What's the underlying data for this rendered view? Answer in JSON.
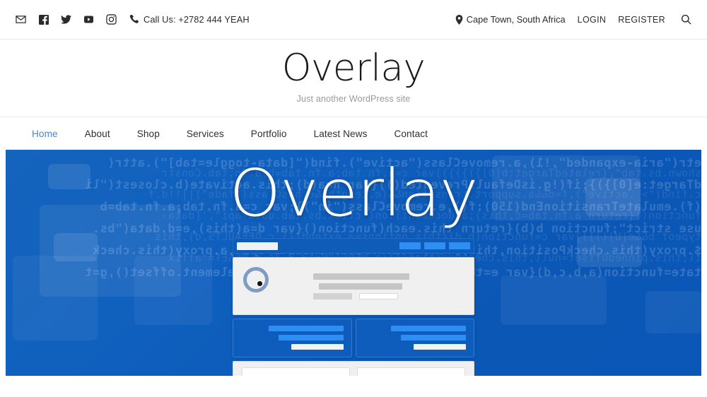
{
  "topbar": {
    "social_icons": [
      {
        "name": "email-icon",
        "label": "Email"
      },
      {
        "name": "facebook-icon",
        "label": "Facebook"
      },
      {
        "name": "twitter-icon",
        "label": "Twitter"
      },
      {
        "name": "youtube-icon",
        "label": "YouTube"
      },
      {
        "name": "instagram-icon",
        "label": "Instagram"
      }
    ],
    "phone_icon": "phone-icon",
    "call_text": "Call Us: +2782 444 YEAH",
    "location_icon": "map-pin-icon",
    "location_text": "Cape Town, South Africa",
    "login_label": "LOGIN",
    "register_label": "REGISTER",
    "search_icon": "search-icon"
  },
  "masthead": {
    "site_title": "Overlay",
    "tagline": "Just another WordPress site"
  },
  "nav": {
    "items": [
      {
        "label": "Home",
        "active": true
      },
      {
        "label": "About",
        "active": false
      },
      {
        "label": "Shop",
        "active": false
      },
      {
        "label": "Services",
        "active": false
      },
      {
        "label": "Portfolio",
        "active": false
      },
      {
        "label": "Latest News",
        "active": false
      },
      {
        "label": "Contact",
        "active": false
      }
    ]
  },
  "hero": {
    "title": "Overlay",
    "background_code_lines": [
      "etr(\"aria-expanded\",!1),a.removeClass(\"active\").find(\"[data-toggle=tab]\").attr(",
      "shown.bs.tab\",{relatedTarget:b[0]})})}}}var c=a.fn.tab;a.fn.tab=b,a.fn.tab.Constr",
      "dTarget:e[0]})};if(!g.isDefaultPrevented()){var h=a(d);this.activate(b.closest(\"li",
      "c.find(\"> .active\"),f=d&&a.support.transition&&(e.length&&e.hasClass(\"fade\")||!!d.f",
      "(f).emulateTransitionEnd(150):f(),e.removeClass(\"in\")};var c=a.fn.tab;a.fn.tab=b",
      "function(){return a.fn.tab=c,this};a(document).on(\"click.bs.tab.data-api\",'[data-",
      "use strict\";function b(b){return this.each(function(){var d=a(this),e=d.data(\"bs.",
      "typeof b&&e[b]()})}var c=function(b,d){this.options=a.extend({},c.DEFAULTS,d),this",
      "$.proxy(this.checkPosition,this)).on(\"click.bs.affix.data-api\",a.proxy(this.check",
      "ll,this.pinnedOffset=null,this.checkPosition()};c.VERSION=\"3.3.7\",c.RESET=\"affix",
      "tate=function(a,b,c,d){var e=this.$target.scrollTop(),f=this.$element.offset(),g=t"
    ],
    "accent_blue": "#0f5cb8",
    "light_blue": "#2f8ef4",
    "panel_gray": "#f0f0f0"
  },
  "mockup": {
    "nav_block_count": 3,
    "card_count": 2,
    "footer_box_count": 2
  },
  "colors": {
    "active_nav": "#4a86c8",
    "text_dark": "#2b2b2b",
    "tagline_gray": "#9a9a9a",
    "hero_blue": "#0f5fbe",
    "border_gray": "#e9e9e9"
  }
}
